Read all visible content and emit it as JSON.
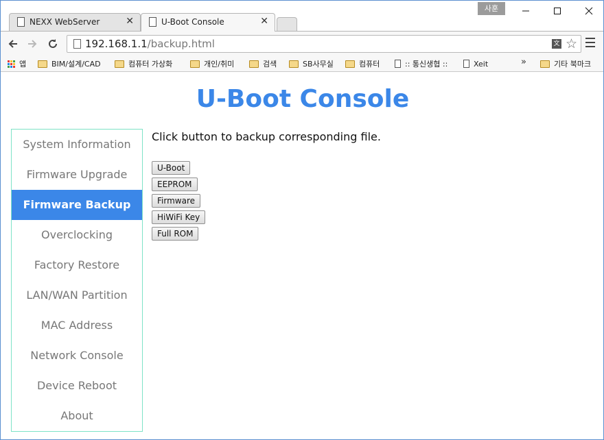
{
  "browser": {
    "profile_badge": "사훈",
    "tabs": [
      {
        "title": "NEXX WebServer",
        "active": false
      },
      {
        "title": "U-Boot Console",
        "active": true
      }
    ],
    "address": {
      "host": "192.168.1.1",
      "path": "/backup.html"
    },
    "bookmarks": [
      {
        "label": "앱",
        "icon": "apps-icon"
      },
      {
        "label": "BIM/설계/CAD",
        "icon": "folder-icon"
      },
      {
        "label": "컴퓨터 가상화",
        "icon": "folder-icon"
      },
      {
        "label": "개인/취미",
        "icon": "folder-icon"
      },
      {
        "label": "검색",
        "icon": "folder-icon"
      },
      {
        "label": "SB사무실",
        "icon": "folder-icon"
      },
      {
        "label": "컴퓨터",
        "icon": "folder-icon"
      },
      {
        "label": ":: 통신생협 ::",
        "icon": "page-icon"
      },
      {
        "label": "Xeit",
        "icon": "page-icon"
      }
    ],
    "overflow": "»",
    "other_bookmarks": "기타 북마크"
  },
  "page": {
    "title": "U-Boot Console",
    "nav_items": [
      {
        "label": "System Information",
        "active": false
      },
      {
        "label": "Firmware Upgrade",
        "active": false
      },
      {
        "label": "Firmware Backup",
        "active": true
      },
      {
        "label": "Overclocking",
        "active": false
      },
      {
        "label": "Factory Restore",
        "active": false
      },
      {
        "label": "LAN/WAN Partition",
        "active": false
      },
      {
        "label": "MAC Address",
        "active": false
      },
      {
        "label": "Network Console",
        "active": false
      },
      {
        "label": "Device Reboot",
        "active": false
      },
      {
        "label": "About",
        "active": false
      }
    ],
    "instruction": "Click button to backup corresponding file.",
    "backup_buttons": [
      "U-Boot",
      "EEPROM",
      "Firmware",
      "HiWiFi Key",
      "Full ROM"
    ]
  },
  "colors": {
    "accent": "#3b87e8",
    "sidebar_border": "#7de3c6",
    "nav_text": "#777777"
  }
}
